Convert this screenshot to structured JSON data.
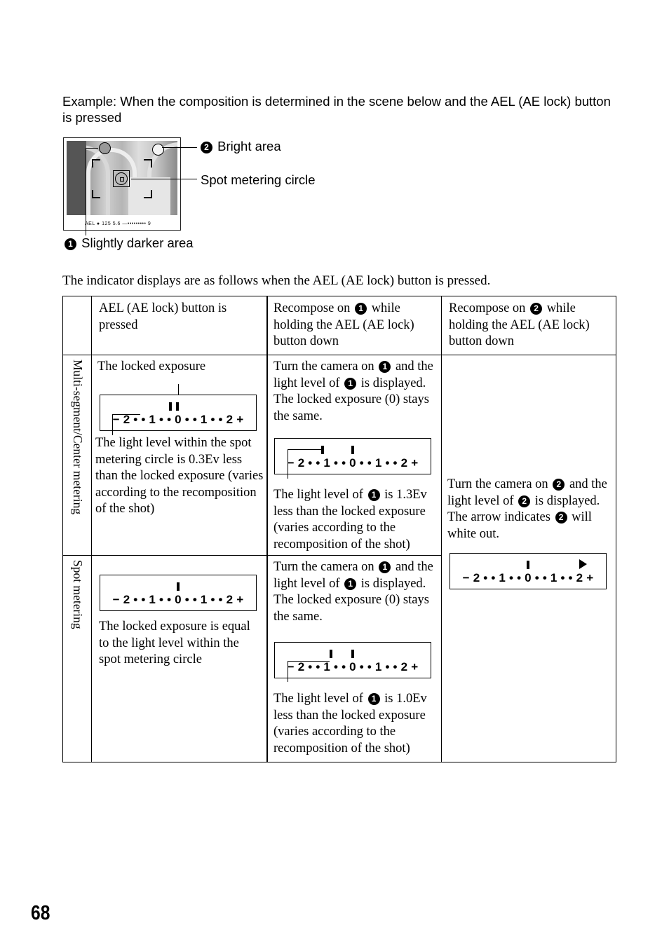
{
  "example_caption": "Example: When the composition is determined in the scene below and the AEL (AE lock) button is pressed",
  "figure": {
    "callouts": {
      "bright_area": {
        "badge": "2",
        "label": "Bright area"
      },
      "spot_circle": {
        "label": "Spot metering circle"
      },
      "darker_area": {
        "badge": "1",
        "label": "Slightly darker area"
      }
    },
    "viewfinder_status": "AEL ●   125  5.6   —•••••••••   9"
  },
  "intro_text": "The indicator displays are as follows when the AEL (AE lock) button is pressed.",
  "table": {
    "headers": {
      "col1": "AEL (AE lock) button is pressed",
      "col2": {
        "before": "Recompose on",
        "badge": "1",
        "after": "while holding the AEL (AE lock) button down"
      },
      "col3": {
        "before": "Recompose on",
        "badge": "2",
        "after": "while holding the AEL (AE lock) button down"
      }
    },
    "rows": [
      {
        "label": "Multi-segment/Center metering",
        "col1": {
          "top": "The locked exposure",
          "bottom": "The light level within the spot metering circle is 0.3Ev less than the locked exposure (varies according to the recomposition of the shot)"
        },
        "col2": {
          "top": [
            "Turn the camera on",
            "1",
            "and the light level of",
            "1",
            "is displayed. The locked exposure (0) stays the same."
          ],
          "bottom": [
            "The light level of",
            "1",
            "is 1.3Ev less than the locked exposure (varies according to the recomposition of the shot)"
          ]
        }
      },
      {
        "label": "Spot metering",
        "col1": {
          "bottom": "The locked exposure is equal to the light level within the spot metering circle"
        },
        "col2": {
          "top": [
            "Turn the camera on",
            "1",
            "and the light level of",
            "1",
            "is displayed. The locked exposure (0) stays the same."
          ],
          "bottom": [
            "The light level of",
            "1",
            "is 1.0Ev less than the locked exposure (varies according to the recomposition of the shot)"
          ]
        }
      }
    ],
    "col3_merged": [
      "Turn the camera on",
      "2",
      "and the light level of",
      "2",
      "is displayed. The arrow indicates",
      "2",
      "will white out."
    ]
  },
  "indicator_scale": "− 2 • • 1 • • 0 • • 1 • • 2 +",
  "indicators": [
    {
      "id": "multi-locked",
      "locked_ev": 0,
      "measured_ev": -0.3
    },
    {
      "id": "multi-recompose-1",
      "locked_ev": 0,
      "measured_ev": -1.3
    },
    {
      "id": "recompose-2",
      "locked_ev": 0,
      "measured": "over-range-arrow"
    },
    {
      "id": "spot-locked",
      "locked_ev": 0,
      "measured_ev": 0
    },
    {
      "id": "spot-recompose-1",
      "locked_ev": 0,
      "measured_ev": -1.0
    }
  ],
  "page_number": "68"
}
